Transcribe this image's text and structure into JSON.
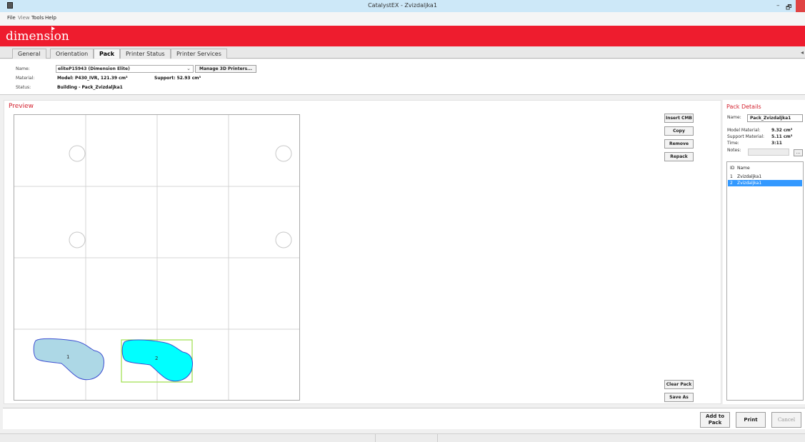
{
  "window": {
    "title": "CatalystEX - Zvizdaljka1",
    "minimize": "–",
    "maximize": "🗗"
  },
  "menu": [
    "File",
    "View",
    "Tools",
    "Help"
  ],
  "brand": {
    "logo": "dimension",
    "color": "#ee1c2e"
  },
  "tabs": [
    "General",
    "Orientation",
    "Pack",
    "Printer Status",
    "Printer Services"
  ],
  "active_tab": "Pack",
  "printer": {
    "name_label": "Name:",
    "name_value": "eliteP15943  (Dimension Elite)",
    "material_label": "Material:",
    "model_value": "Model: P430_IVR, 121.39 cm³",
    "support_value": "Support: 52.93 cm³",
    "status_label": "Status:",
    "status_value": "Building - Pack_Zvizdaljka1",
    "manage_button": "Manage 3D Printers..."
  },
  "preview": {
    "title": "Preview",
    "parts": [
      {
        "id": "1",
        "selected": false,
        "fill": "#add8e6"
      },
      {
        "id": "2",
        "selected": true,
        "fill": "#00ffff"
      }
    ]
  },
  "actions": {
    "insert": "Insert CMB",
    "copy": "Copy",
    "remove": "Remove",
    "repack": "Repack",
    "clear": "Clear Pack",
    "save_as": "Save As"
  },
  "pack_details": {
    "title": "Pack Details",
    "name_label": "Name:",
    "name_value": "Pack_Zvizdaljka1",
    "model_material_label": "Model Material:",
    "model_material_value": "9.32 cm³",
    "support_material_label": "Support Material:",
    "support_material_value": "5.11 cm³",
    "time_label": "Time:",
    "time_value": "3:11",
    "notes_label": "Notes:",
    "notes_button": "...",
    "list_headers": {
      "id": "ID",
      "name": "Name"
    },
    "items": [
      {
        "id": "1",
        "name": "Zvizdaljka1",
        "selected": false
      },
      {
        "id": "2",
        "name": "Zvizdaljka1",
        "selected": true
      }
    ]
  },
  "footer": {
    "add_to_pack": "Add to Pack",
    "print": "Print",
    "cancel": "Cancel"
  }
}
